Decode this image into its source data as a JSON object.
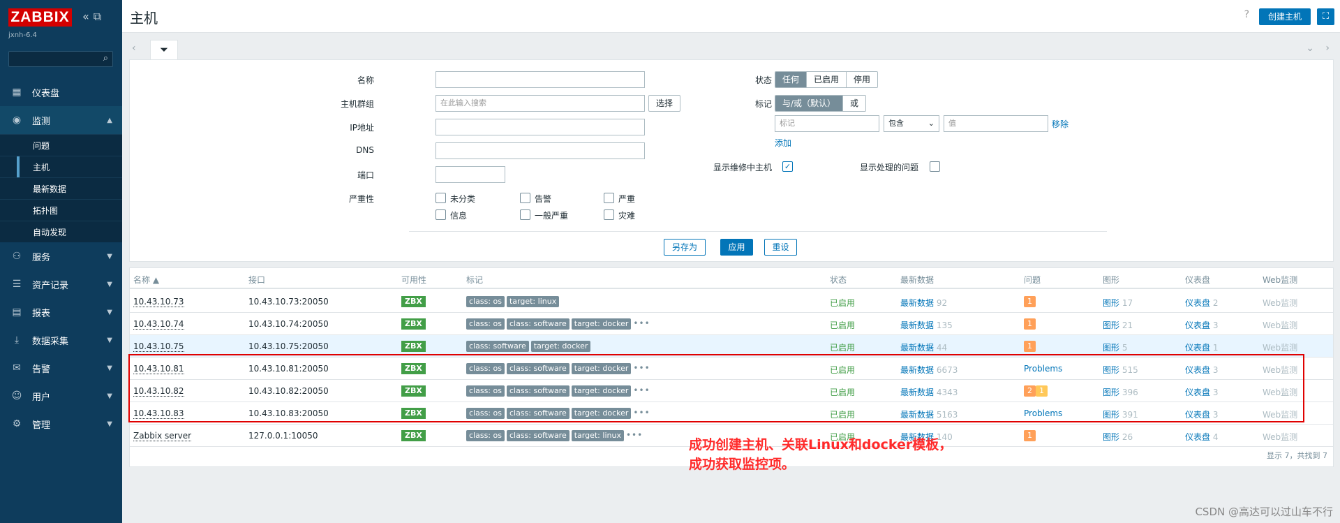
{
  "sidebar": {
    "logo": "ZABBIX",
    "instance": "jxnh-6.4",
    "nav": [
      {
        "label": "仪表盘"
      },
      {
        "label": "监测"
      },
      {
        "label": "服务"
      },
      {
        "label": "资产记录"
      },
      {
        "label": "报表"
      },
      {
        "label": "数据采集"
      },
      {
        "label": "告警"
      },
      {
        "label": "用户"
      },
      {
        "label": "管理"
      }
    ],
    "sub": [
      "问题",
      "主机",
      "最新数据",
      "拓扑图",
      "自动发现"
    ]
  },
  "header": {
    "title": "主机",
    "help": "?",
    "create_label": "创建主机"
  },
  "filter": {
    "name_label": "名称",
    "group_label": "主机群组",
    "group_placeholder": "在此输入搜索",
    "select_label": "选择",
    "ip_label": "IP地址",
    "dns_label": "DNS",
    "port_label": "端口",
    "severity_label": "严重性",
    "severities": [
      "未分类",
      "告警",
      "严重",
      "信息",
      "一般严重",
      "灾难"
    ],
    "status_label": "状态",
    "status_options": [
      "任何",
      "已启用",
      "停用"
    ],
    "tags_label": "标记",
    "tag_options": [
      "与/或（默认）",
      "或"
    ],
    "tag_placeholder": "标记",
    "tag_op": "包含",
    "value_placeholder": "值",
    "remove_label": "移除",
    "add_label": "添加",
    "maint_label": "显示维修中主机",
    "suppressed_label": "显示处理的问题",
    "save_as_label": "另存为",
    "apply_label": "应用",
    "reset_label": "重设"
  },
  "table": {
    "columns": [
      "名称 ▲",
      "接口",
      "可用性",
      "标记",
      "状态",
      "最新数据",
      "问题",
      "图形",
      "仪表盘",
      "Web监测"
    ],
    "rows": [
      {
        "name": "10.43.10.73",
        "iface": "10.43.10.73:20050",
        "avail": "ZBX",
        "tags": [
          "class: os",
          "target: linux"
        ],
        "more": false,
        "status": "已启用",
        "latest_label": "最新数据",
        "latest": "92",
        "problems_type": "badge",
        "problems": [
          "1"
        ],
        "graphs_label": "图形",
        "graphs": "17",
        "dash_label": "仪表盘",
        "dash": "2",
        "web": "Web监测"
      },
      {
        "name": "10.43.10.74",
        "iface": "10.43.10.74:20050",
        "avail": "ZBX",
        "tags": [
          "class: os",
          "class: software",
          "target: docker"
        ],
        "more": true,
        "status": "已启用",
        "latest_label": "最新数据",
        "latest": "135",
        "problems_type": "badge",
        "problems": [
          "1"
        ],
        "graphs_label": "图形",
        "graphs": "21",
        "dash_label": "仪表盘",
        "dash": "3",
        "web": "Web监测"
      },
      {
        "name": "10.43.10.75",
        "iface": "10.43.10.75:20050",
        "avail": "ZBX",
        "tags": [
          "class: software",
          "target: docker"
        ],
        "more": false,
        "status": "已启用",
        "latest_label": "最新数据",
        "latest": "44",
        "problems_type": "badge",
        "problems": [
          "1"
        ],
        "graphs_label": "图形",
        "graphs": "5",
        "dash_label": "仪表盘",
        "dash": "1",
        "web": "Web监测"
      },
      {
        "name": "10.43.10.81",
        "iface": "10.43.10.81:20050",
        "avail": "ZBX",
        "tags": [
          "class: os",
          "class: software",
          "target: docker"
        ],
        "more": true,
        "status": "已启用",
        "latest_label": "最新数据",
        "latest": "6673",
        "problems_type": "link",
        "problems": [
          "Problems"
        ],
        "graphs_label": "图形",
        "graphs": "515",
        "dash_label": "仪表盘",
        "dash": "3",
        "web": "Web监测"
      },
      {
        "name": "10.43.10.82",
        "iface": "10.43.10.82:20050",
        "avail": "ZBX",
        "tags": [
          "class: os",
          "class: software",
          "target: docker"
        ],
        "more": true,
        "status": "已启用",
        "latest_label": "最新数据",
        "latest": "4343",
        "problems_type": "badge2",
        "problems": [
          "2",
          "1"
        ],
        "graphs_label": "图形",
        "graphs": "396",
        "dash_label": "仪表盘",
        "dash": "3",
        "web": "Web监测"
      },
      {
        "name": "10.43.10.83",
        "iface": "10.43.10.83:20050",
        "avail": "ZBX",
        "tags": [
          "class: os",
          "class: software",
          "target: docker"
        ],
        "more": true,
        "status": "已启用",
        "latest_label": "最新数据",
        "latest": "5163",
        "problems_type": "link",
        "problems": [
          "Problems"
        ],
        "graphs_label": "图形",
        "graphs": "391",
        "dash_label": "仪表盘",
        "dash": "3",
        "web": "Web监测"
      },
      {
        "name": "Zabbix server",
        "iface": "127.0.0.1:10050",
        "avail": "ZBX",
        "tags": [
          "class: os",
          "class: software",
          "target: linux"
        ],
        "more": true,
        "status": "已启用",
        "latest_label": "最新数据",
        "latest": "140",
        "problems_type": "badge",
        "problems": [
          "1"
        ],
        "graphs_label": "图形",
        "graphs": "26",
        "dash_label": "仪表盘",
        "dash": "4",
        "web": "Web监测"
      }
    ],
    "footer": "显示 7，共找到 7"
  },
  "annotation": {
    "line1": "成功创建主机、关联Linux和docker模板，",
    "line2": "成功获取监控项。"
  },
  "watermark": "CSDN @高达可以过山车不行",
  "colors": {
    "sidebar": "#0e3c5c",
    "accent": "#0275b8",
    "zbx": "#429e47",
    "highlight_box": "#e00000"
  }
}
